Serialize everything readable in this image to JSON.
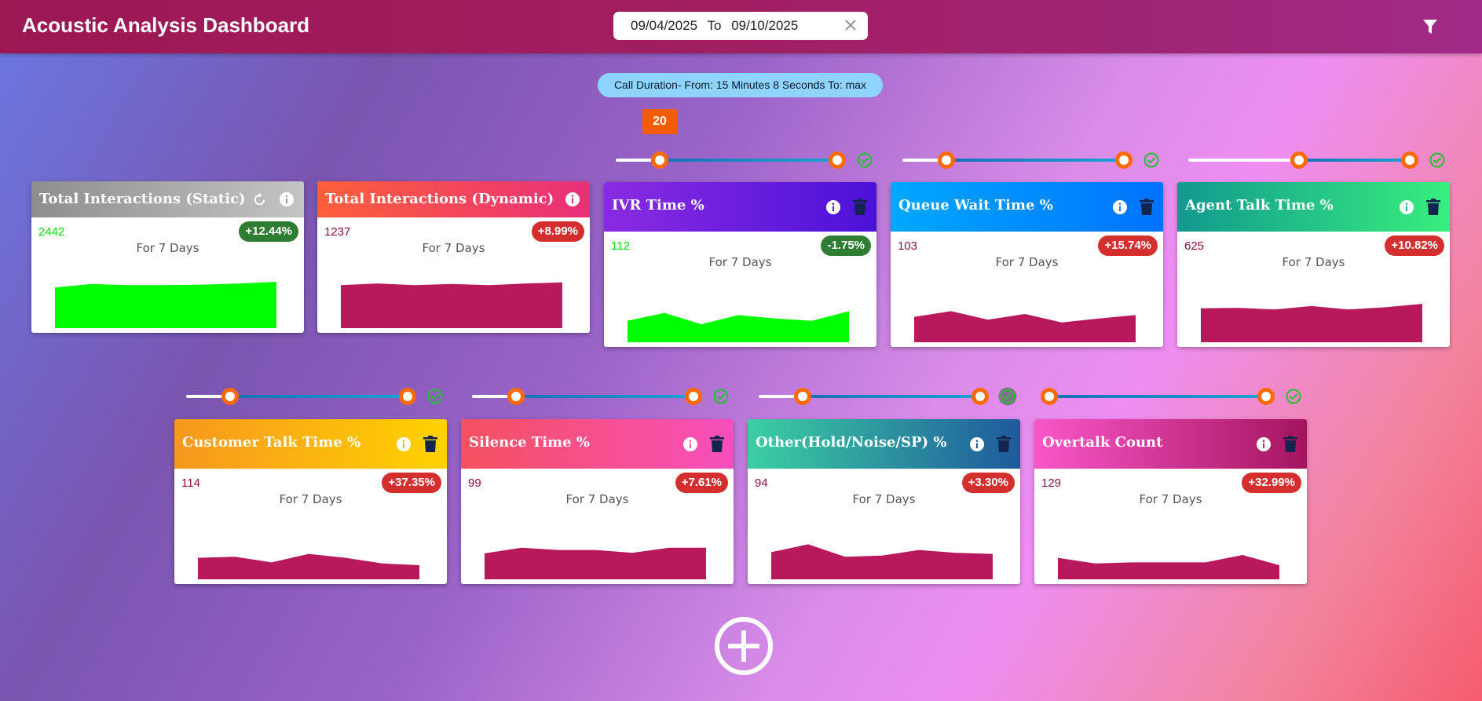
{
  "header": {
    "title": "Acoustic Analysis Dashboard",
    "date_from": "09/04/2025",
    "date_sep": "To",
    "date_to": "09/10/2025"
  },
  "filter_chip": "Call Duration- From: 15 Minutes 8 Seconds To: max",
  "slider_tooltip": "20",
  "cards": [
    {
      "title": "Total Interactions (Static)",
      "value": "2442",
      "change": "+12.44%",
      "period": "For 7 Days",
      "trend": [
        72,
        78,
        76,
        76,
        77,
        79,
        82
      ],
      "value_color": "#00e000",
      "badge": "green",
      "fill": "#00ff00",
      "head": "linear-gradient(90deg,#8e8e8e,#c4c4c4)"
    },
    {
      "title": "Total Interactions (Dynamic)",
      "value": "1237",
      "change": "+8.99%",
      "period": "For 7 Days",
      "trend": [
        76,
        79,
        76,
        78,
        76,
        79,
        81
      ],
      "value_color": "#8a1040",
      "badge": "red",
      "fill": "#b8185c",
      "head": "linear-gradient(90deg,#ff5f3a,#e8307a)"
    },
    {
      "title": "IVR Time %",
      "value": "112",
      "change": "-1.75%",
      "period": "For 7 Days",
      "trend": [
        38,
        52,
        32,
        48,
        42,
        38,
        55
      ],
      "value_color": "#00e000",
      "badge": "green",
      "fill": "#00ff00",
      "head": "linear-gradient(90deg,#8a2be2,#4b12d8)"
    },
    {
      "title": "Queue Wait Time %",
      "value": "103",
      "change": "+15.74%",
      "period": "For 7 Days",
      "trend": [
        45,
        55,
        40,
        50,
        35,
        42,
        48
      ],
      "value_color": "#8a1040",
      "badge": "red",
      "fill": "#b8185c",
      "head": "linear-gradient(90deg,#00a8ff,#0072ff)"
    },
    {
      "title": "Agent Talk Time %",
      "value": "625",
      "change": "+10.82%",
      "period": "For 7 Days",
      "trend": [
        60,
        61,
        58,
        64,
        58,
        62,
        68
      ],
      "value_color": "#8a1040",
      "badge": "red",
      "fill": "#b8185c",
      "head": "linear-gradient(90deg,#11998e,#38ef7d)"
    },
    {
      "title": "Customer Talk Time %",
      "value": "114",
      "change": "+37.35%",
      "period": "For 7 Days",
      "trend": [
        38,
        40,
        30,
        45,
        38,
        28,
        25
      ],
      "value_color": "#8a1040",
      "badge": "red",
      "fill": "#b8185c",
      "head": "linear-gradient(90deg,#f7971e,#ffd200)"
    },
    {
      "title": "Silence Time %",
      "value": "99",
      "change": "+7.61%",
      "period": "For 7 Days",
      "trend": [
        46,
        56,
        52,
        52,
        47,
        56,
        56
      ],
      "value_color": "#8a1040",
      "badge": "red",
      "fill": "#b8185c",
      "head": "linear-gradient(90deg,#f5515f,#f64fbd)"
    },
    {
      "title": "Other(Hold/Noise/SP) %",
      "value": "94",
      "change": "+3.30%",
      "period": "For 7 Days",
      "trend": [
        48,
        62,
        40,
        42,
        52,
        47,
        45
      ],
      "value_color": "#8a1040",
      "badge": "red",
      "fill": "#b8185c",
      "head": "linear-gradient(90deg,#3ccfa3,#1e5a9b)"
    },
    {
      "title": "Overtalk Count",
      "value": "129",
      "change": "+32.99%",
      "period": "For 7 Days",
      "trend": [
        38,
        28,
        30,
        30,
        30,
        43,
        25
      ],
      "value_color": "#8a1040",
      "badge": "red",
      "fill": "#b8185c",
      "head": "linear-gradient(90deg,#f957c9,#a4145e)"
    }
  ],
  "icons": {
    "date_clear": "close-icon",
    "filter": "filter-icon",
    "refresh": "refresh-icon",
    "info": "info-icon",
    "delete": "trash-icon",
    "confirm": "check-circle-icon",
    "add": "add-circle-icon"
  }
}
